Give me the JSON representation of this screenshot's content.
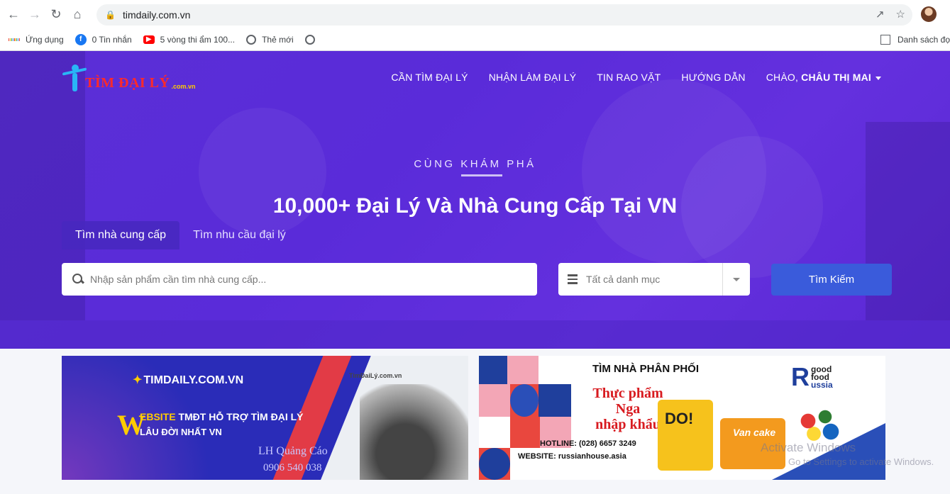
{
  "browser": {
    "url": "timdaily.com.vn",
    "bookmarks": [
      {
        "label": "Ứng dụng",
        "icon": "apps-grid-icon"
      },
      {
        "label": "0 Tin nhắn",
        "icon": "facebook-icon"
      },
      {
        "label": "5 vòng thi ẩm 100...",
        "icon": "youtube-icon"
      },
      {
        "label": "Thẻ mới",
        "icon": "globe-icon"
      },
      {
        "label": "",
        "icon": "globe-icon"
      }
    ],
    "reading_list_label": "Danh sách đọ"
  },
  "site": {
    "logo_text": "TÌM ĐẠI LÝ",
    "logo_domain": ".com.vn",
    "nav": [
      {
        "label": "CẦN TÌM ĐẠI LÝ"
      },
      {
        "label": "NHẬN LÀM ĐẠI LÝ"
      },
      {
        "label": "TIN RAO VẶT"
      },
      {
        "label": "HƯỚNG DẪN"
      }
    ],
    "greeting_prefix": "CHÀO, ",
    "greeting_name": "CHÂU THỊ MAI"
  },
  "hero": {
    "kicker": "CÙNG KHÁM PHÁ",
    "headline": "10,000+ Đại Lý Và Nhà Cung Cấp Tại VN",
    "tabs": [
      {
        "label": "Tìm nhà cung cấp",
        "active": true
      },
      {
        "label": "Tìm nhu cầu đại lý",
        "active": false
      }
    ],
    "search_placeholder": "Nhập sản phẩm cần tìm nhà cung cấp...",
    "category_label": "Tất cả danh mục",
    "search_button": "Tìm Kiếm"
  },
  "banners": {
    "left": {
      "brand": "TIMDAILY.COM.VN",
      "small_brand": "TimĐaiLý.com.vn",
      "w_letter": "W",
      "line1_highlight": "EBSITE",
      "line1_rest": " TMĐT HỖ TRỢ TÌM ĐẠI LÝ",
      "line2": "LÂU ĐỜI NHẤT VN",
      "contact": "LH Quảng Cáo",
      "phone": "0906 540 038"
    },
    "right": {
      "kicker": "TÌM NHÀ PHÂN PHỐI",
      "title_lines": [
        "Thực phẩm",
        "Nga",
        "nhập khẩu"
      ],
      "hotline": "HOTLINE: (028) 6657 3249",
      "website": "WEBSITE: russianhouse.asia",
      "brand_r": "R",
      "brand_words": [
        "good",
        "food",
        "ussia"
      ],
      "pkg1": "DO!",
      "pkg2": "Van cake"
    }
  },
  "watermark": {
    "line1": "Activate Windows",
    "line2": "Go to Settings to activate Windows."
  },
  "colors": {
    "hero": "#5b2fd6",
    "button": "#3a5bdb",
    "accent_red": "#e23b46"
  }
}
